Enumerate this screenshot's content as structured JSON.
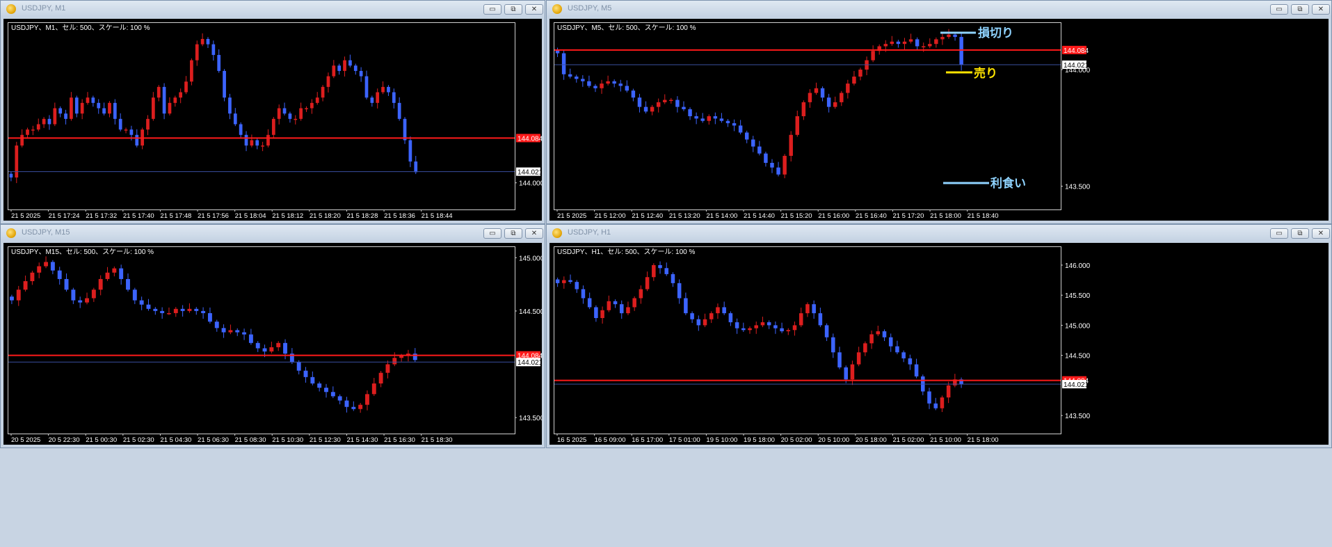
{
  "colors": {
    "bull": "#dc1e1e",
    "bear": "#3c64ff",
    "level_line": "#ff1a1a",
    "bid_line": "#3a4fa0",
    "stop_line": "#8fd3ff",
    "sell_line": "#ffe400",
    "take_line": "#8fd3ff"
  },
  "windows": [
    {
      "id": "m1",
      "title": "USDJPY, M1",
      "header": "USDJPY、M1、セル: 500、スケール: 100 %",
      "min_label": "▭",
      "max_label": "⧉",
      "close_label": "✕",
      "price_range": [
        143.95,
        144.3
      ],
      "level_price": "144.084",
      "bid_price": "144.021",
      "y_ticks": [
        "144.000"
      ],
      "x_ticks": [
        "21 5 2025",
        "21 5 17:24",
        "21 5 17:32",
        "21 5 17:40",
        "21 5 17:48",
        "21 5 17:56",
        "21 5 18:04",
        "21 5 18:12",
        "21 5 18:20",
        "21 5 18:28",
        "21 5 18:36",
        "21 5 18:44"
      ]
    },
    {
      "id": "m5",
      "title": "USDJPY, M5",
      "header": "USDJPY、M5、セル: 500、スケール: 100 %",
      "min_label": "▭",
      "max_label": "⧉",
      "close_label": "✕",
      "price_range": [
        143.4,
        144.2
      ],
      "level_price": "144.084",
      "bid_price": "144.021",
      "y_ticks": [
        "144.000",
        "143.500"
      ],
      "x_ticks": [
        "21 5 2025",
        "21 5 12:00",
        "21 5 12:40",
        "21 5 13:20",
        "21 5 14:00",
        "21 5 14:40",
        "21 5 15:20",
        "21 5 16:00",
        "21 5 16:40",
        "21 5 17:20",
        "21 5 18:00",
        "21 5 18:40"
      ],
      "annotations": {
        "stop_loss": "損切り",
        "sell": "売り",
        "take_profit": "利食い"
      }
    },
    {
      "id": "m15",
      "title": "USDJPY, M15",
      "header": "USDJPY、M15、セル: 500、スケール: 100 %",
      "min_label": "▭",
      "max_label": "⧉",
      "close_label": "✕",
      "price_range": [
        143.35,
        145.1
      ],
      "level_price": "144.084",
      "bid_price": "144.021",
      "y_ticks": [
        "145.000",
        "144.500",
        "143.500"
      ],
      "x_ticks": [
        "20 5 2025",
        "20 5 22:30",
        "21 5 00:30",
        "21 5 02:30",
        "21 5 04:30",
        "21 5 06:30",
        "21 5 08:30",
        "21 5 10:30",
        "21 5 12:30",
        "21 5 14:30",
        "21 5 16:30",
        "21 5 18:30"
      ]
    },
    {
      "id": "h1",
      "title": "USDJPY, H1",
      "header": "USDJPY、H1、セル: 500、スケール: 100 %",
      "min_label": "▭",
      "max_label": "⧉",
      "close_label": "✕",
      "price_range": [
        143.2,
        146.3
      ],
      "level_price": "144.084",
      "bid_price": "144.021",
      "y_ticks": [
        "146.000",
        "145.500",
        "145.000",
        "144.500",
        "143.500"
      ],
      "x_ticks": [
        "16 5 2025",
        "16 5 09:00",
        "16 5 17:00",
        "17 5 01:00",
        "19 5 10:00",
        "19 5 18:00",
        "20 5 02:00",
        "20 5 10:00",
        "20 5 18:00",
        "21 5 02:00",
        "21 5 10:00",
        "21 5 18:00"
      ]
    }
  ],
  "chart_data": [
    {
      "type": "candlestick",
      "title": "USDJPY, M1",
      "ylim": [
        143.95,
        144.3
      ],
      "closes": [
        144.01,
        144.07,
        144.09,
        144.1,
        144.1,
        144.11,
        144.12,
        144.11,
        144.14,
        144.13,
        144.12,
        144.16,
        144.13,
        144.15,
        144.16,
        144.15,
        144.14,
        144.13,
        144.15,
        144.12,
        144.1,
        144.1,
        144.09,
        144.07,
        144.1,
        144.12,
        144.16,
        144.18,
        144.13,
        144.15,
        144.16,
        144.17,
        144.19,
        144.23,
        144.26,
        144.27,
        144.26,
        144.24,
        144.21,
        144.16,
        144.13,
        144.11,
        144.09,
        144.07,
        144.08,
        144.07,
        144.07,
        144.09,
        144.12,
        144.14,
        144.13,
        144.12,
        144.12,
        144.14,
        144.14,
        144.15,
        144.16,
        144.18,
        144.2,
        144.22,
        144.21,
        144.23,
        144.22,
        144.21,
        144.2,
        144.16,
        144.15,
        144.17,
        144.18,
        144.17,
        144.15,
        144.12,
        144.08,
        144.04,
        144.02
      ]
    },
    {
      "type": "candlestick",
      "title": "USDJPY, M5",
      "ylim": [
        143.4,
        144.2
      ],
      "closes": [
        144.07,
        143.98,
        143.97,
        143.96,
        143.95,
        143.93,
        143.92,
        143.94,
        143.95,
        143.94,
        143.93,
        143.91,
        143.88,
        143.84,
        143.82,
        143.84,
        143.86,
        143.87,
        143.87,
        143.84,
        143.83,
        143.8,
        143.79,
        143.78,
        143.8,
        143.79,
        143.78,
        143.77,
        143.76,
        143.73,
        143.7,
        143.67,
        143.64,
        143.6,
        143.58,
        143.55,
        143.63,
        143.72,
        143.8,
        143.86,
        143.9,
        143.92,
        143.88,
        143.84,
        143.86,
        143.9,
        143.94,
        143.97,
        144.0,
        144.04,
        144.08,
        144.1,
        144.11,
        144.12,
        144.11,
        144.12,
        144.13,
        144.1,
        144.1,
        144.11,
        144.13,
        144.14,
        144.15,
        144.14,
        144.02
      ]
    },
    {
      "type": "candlestick",
      "title": "USDJPY, M15",
      "ylim": [
        143.35,
        145.1
      ],
      "closes": [
        144.6,
        144.7,
        144.78,
        144.86,
        144.92,
        144.96,
        144.88,
        144.8,
        144.7,
        144.6,
        144.58,
        144.62,
        144.7,
        144.8,
        144.86,
        144.9,
        144.8,
        144.7,
        144.6,
        144.56,
        144.52,
        144.5,
        144.48,
        144.48,
        144.52,
        144.5,
        144.52,
        144.5,
        144.48,
        144.4,
        144.34,
        144.3,
        144.32,
        144.3,
        144.28,
        144.2,
        144.15,
        144.12,
        144.16,
        144.2,
        144.1,
        144.02,
        143.94,
        143.88,
        143.82,
        143.78,
        143.74,
        143.7,
        143.66,
        143.6,
        143.58,
        143.62,
        143.72,
        143.82,
        143.92,
        144.0,
        144.06,
        144.08,
        144.1,
        144.04
      ]
    },
    {
      "type": "candlestick",
      "title": "USDJPY, H1",
      "ylim": [
        143.2,
        146.3
      ],
      "closes": [
        145.7,
        145.75,
        145.72,
        145.6,
        145.45,
        145.3,
        145.12,
        145.25,
        145.4,
        145.35,
        145.2,
        145.3,
        145.45,
        145.6,
        145.8,
        146.0,
        145.95,
        145.85,
        145.7,
        145.45,
        145.2,
        145.1,
        145.0,
        145.1,
        145.2,
        145.3,
        145.2,
        145.05,
        144.95,
        144.92,
        144.95,
        145.0,
        145.05,
        145.0,
        144.95,
        144.9,
        144.92,
        145.0,
        145.2,
        145.35,
        145.2,
        145.0,
        144.8,
        144.55,
        144.3,
        144.1,
        144.35,
        144.55,
        144.7,
        144.85,
        144.9,
        144.8,
        144.65,
        144.55,
        144.45,
        144.35,
        144.15,
        143.9,
        143.7,
        143.62,
        143.8,
        144.0,
        144.1,
        144.02
      ]
    }
  ]
}
